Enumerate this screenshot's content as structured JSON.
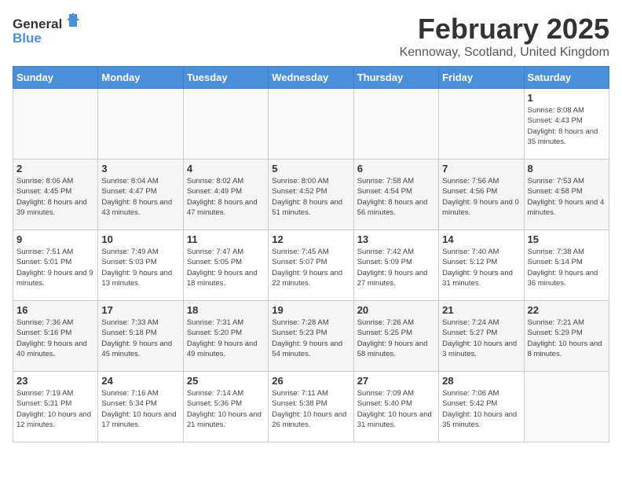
{
  "header": {
    "logo_general": "General",
    "logo_blue": "Blue",
    "title": "February 2025",
    "subtitle": "Kennoway, Scotland, United Kingdom"
  },
  "weekdays": [
    "Sunday",
    "Monday",
    "Tuesday",
    "Wednesday",
    "Thursday",
    "Friday",
    "Saturday"
  ],
  "weeks": [
    [
      {
        "day": "",
        "info": ""
      },
      {
        "day": "",
        "info": ""
      },
      {
        "day": "",
        "info": ""
      },
      {
        "day": "",
        "info": ""
      },
      {
        "day": "",
        "info": ""
      },
      {
        "day": "",
        "info": ""
      },
      {
        "day": "1",
        "info": "Sunrise: 8:08 AM\nSunset: 4:43 PM\nDaylight: 8 hours and 35 minutes."
      }
    ],
    [
      {
        "day": "2",
        "info": "Sunrise: 8:06 AM\nSunset: 4:45 PM\nDaylight: 8 hours and 39 minutes."
      },
      {
        "day": "3",
        "info": "Sunrise: 8:04 AM\nSunset: 4:47 PM\nDaylight: 8 hours and 43 minutes."
      },
      {
        "day": "4",
        "info": "Sunrise: 8:02 AM\nSunset: 4:49 PM\nDaylight: 8 hours and 47 minutes."
      },
      {
        "day": "5",
        "info": "Sunrise: 8:00 AM\nSunset: 4:52 PM\nDaylight: 8 hours and 51 minutes."
      },
      {
        "day": "6",
        "info": "Sunrise: 7:58 AM\nSunset: 4:54 PM\nDaylight: 8 hours and 56 minutes."
      },
      {
        "day": "7",
        "info": "Sunrise: 7:56 AM\nSunset: 4:56 PM\nDaylight: 9 hours and 0 minutes."
      },
      {
        "day": "8",
        "info": "Sunrise: 7:53 AM\nSunset: 4:58 PM\nDaylight: 9 hours and 4 minutes."
      }
    ],
    [
      {
        "day": "9",
        "info": "Sunrise: 7:51 AM\nSunset: 5:01 PM\nDaylight: 9 hours and 9 minutes."
      },
      {
        "day": "10",
        "info": "Sunrise: 7:49 AM\nSunset: 5:03 PM\nDaylight: 9 hours and 13 minutes."
      },
      {
        "day": "11",
        "info": "Sunrise: 7:47 AM\nSunset: 5:05 PM\nDaylight: 9 hours and 18 minutes."
      },
      {
        "day": "12",
        "info": "Sunrise: 7:45 AM\nSunset: 5:07 PM\nDaylight: 9 hours and 22 minutes."
      },
      {
        "day": "13",
        "info": "Sunrise: 7:42 AM\nSunset: 5:09 PM\nDaylight: 9 hours and 27 minutes."
      },
      {
        "day": "14",
        "info": "Sunrise: 7:40 AM\nSunset: 5:12 PM\nDaylight: 9 hours and 31 minutes."
      },
      {
        "day": "15",
        "info": "Sunrise: 7:38 AM\nSunset: 5:14 PM\nDaylight: 9 hours and 36 minutes."
      }
    ],
    [
      {
        "day": "16",
        "info": "Sunrise: 7:36 AM\nSunset: 5:16 PM\nDaylight: 9 hours and 40 minutes."
      },
      {
        "day": "17",
        "info": "Sunrise: 7:33 AM\nSunset: 5:18 PM\nDaylight: 9 hours and 45 minutes."
      },
      {
        "day": "18",
        "info": "Sunrise: 7:31 AM\nSunset: 5:20 PM\nDaylight: 9 hours and 49 minutes."
      },
      {
        "day": "19",
        "info": "Sunrise: 7:28 AM\nSunset: 5:23 PM\nDaylight: 9 hours and 54 minutes."
      },
      {
        "day": "20",
        "info": "Sunrise: 7:26 AM\nSunset: 5:25 PM\nDaylight: 9 hours and 58 minutes."
      },
      {
        "day": "21",
        "info": "Sunrise: 7:24 AM\nSunset: 5:27 PM\nDaylight: 10 hours and 3 minutes."
      },
      {
        "day": "22",
        "info": "Sunrise: 7:21 AM\nSunset: 5:29 PM\nDaylight: 10 hours and 8 minutes."
      }
    ],
    [
      {
        "day": "23",
        "info": "Sunrise: 7:19 AM\nSunset: 5:31 PM\nDaylight: 10 hours and 12 minutes."
      },
      {
        "day": "24",
        "info": "Sunrise: 7:16 AM\nSunset: 5:34 PM\nDaylight: 10 hours and 17 minutes."
      },
      {
        "day": "25",
        "info": "Sunrise: 7:14 AM\nSunset: 5:36 PM\nDaylight: 10 hours and 21 minutes."
      },
      {
        "day": "26",
        "info": "Sunrise: 7:11 AM\nSunset: 5:38 PM\nDaylight: 10 hours and 26 minutes."
      },
      {
        "day": "27",
        "info": "Sunrise: 7:09 AM\nSunset: 5:40 PM\nDaylight: 10 hours and 31 minutes."
      },
      {
        "day": "28",
        "info": "Sunrise: 7:06 AM\nSunset: 5:42 PM\nDaylight: 10 hours and 35 minutes."
      },
      {
        "day": "",
        "info": ""
      }
    ]
  ]
}
